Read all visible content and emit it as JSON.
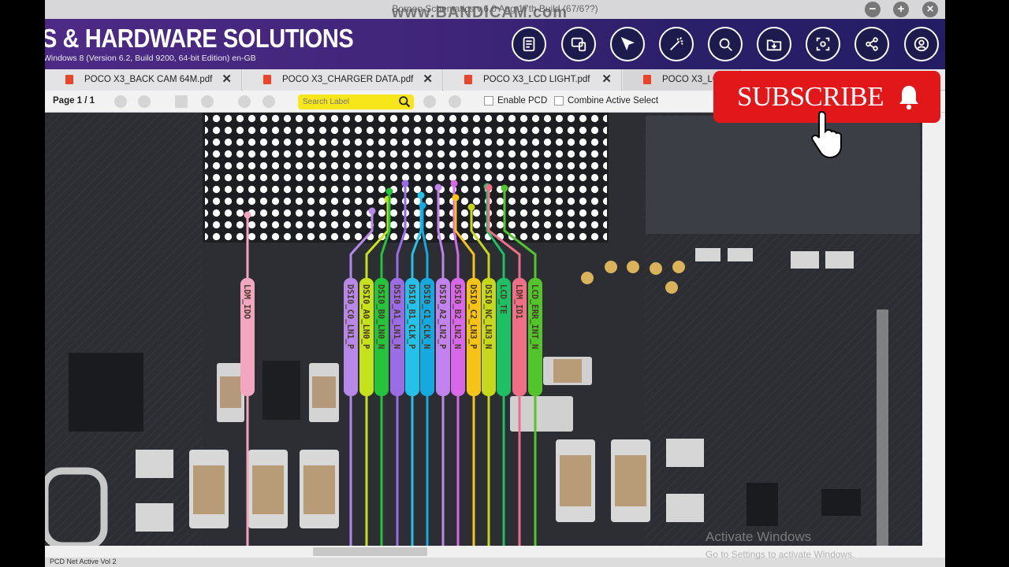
{
  "window": {
    "title": "Borneo Schematics v.6.0 Aug 17th Build (67/6??)",
    "watermark": "www.BANDICAM.com",
    "minimize": "−",
    "maximize": "+",
    "close": "×"
  },
  "banner": {
    "title": "S & HARDWARE SOLUTIONS",
    "subtitle": "Windows 8 (Version 6.2, Build 9200, 64-bit Edition) en-GB",
    "icons": [
      "document-icon",
      "device-icon",
      "pointer-icon",
      "magic-wand-icon",
      "zoom-icon",
      "folder-download-icon",
      "scan-icon",
      "share-icon",
      "user-icon"
    ]
  },
  "tabs": [
    {
      "label": "POCO X3_BACK CAM 64M.pdf"
    },
    {
      "label": "POCO X3_CHARGER DATA.pdf"
    },
    {
      "label": "POCO X3_LCD LIGHT.pdf"
    },
    {
      "label": "POCO X3_LC"
    }
  ],
  "toolbar": {
    "page": "Page 1 / 1",
    "search_placeholder": "Search Label",
    "enable_pcd": "Enable PCD",
    "combine_active_select": "Combine Active Select"
  },
  "nets": [
    {
      "label": "LDM_IDO",
      "color": "#f2a6c0"
    },
    {
      "label": "DSI0_C0_LN1_P",
      "color": "#b788e8"
    },
    {
      "label": "DSI0_A0_LN0_P",
      "color": "#c6e21c"
    },
    {
      "label": "DSI0_B0_LN0_N",
      "color": "#25c43a"
    },
    {
      "label": "DSI0_A1_LN1_N",
      "color": "#9a6ce6"
    },
    {
      "label": "DSI0_B1_CLK_P",
      "color": "#26c1e8"
    },
    {
      "label": "DSI0_C1_CLK_N",
      "color": "#15a9e0"
    },
    {
      "label": "DSI0_A2_LN2_P",
      "color": "#c083f0"
    },
    {
      "label": "DSI0_B2_LN2_N",
      "color": "#d768e8"
    },
    {
      "label": "DSI0_C2_LN3_P",
      "color": "#f6c419"
    },
    {
      "label": "DSI0_NC_LN3_N",
      "color": "#c6d81a"
    },
    {
      "label": "LCD_TE",
      "color": "#1fbf63"
    },
    {
      "label": "LDM_ID1",
      "color": "#ee6f86"
    },
    {
      "label": "LCD_ERR_INT_N",
      "color": "#52c42c"
    }
  ],
  "subscribe": {
    "label": "SUBSCRIBE"
  },
  "activate": {
    "line1": "Activate Windows",
    "line2": "Go to Settings to activate Windows."
  },
  "status": {
    "text": "PCD Net Active Vol 2"
  }
}
